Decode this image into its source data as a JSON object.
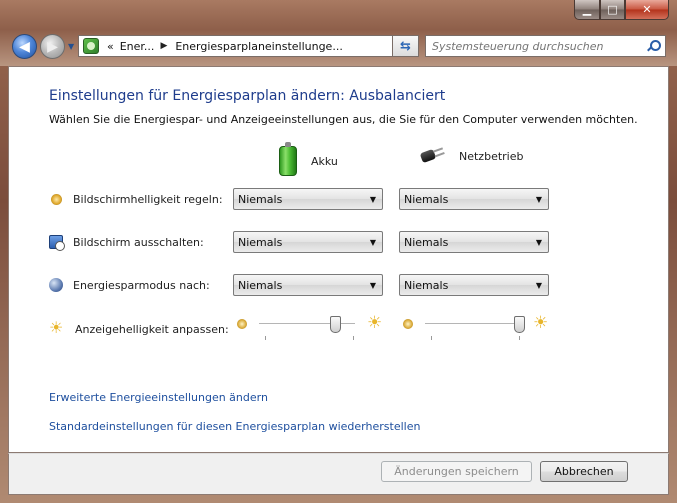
{
  "window": {
    "controls": {
      "minimize": "▁",
      "maximize": "□",
      "close": "✕"
    }
  },
  "nav": {
    "breadcrumb": [
      "Ener...",
      "Energiesparplaneinstellunge..."
    ],
    "breadcrumb_prefix": "«",
    "search_placeholder": "Systemsteuerung durchsuchen"
  },
  "page": {
    "title": "Einstellungen für Energiesparplan ändern: Ausbalanciert",
    "subtitle": "Wählen Sie die Energiespar- und Anzeigeeinstellungen aus, die Sie für den Computer verwenden möchten.",
    "columns": {
      "battery": "Akku",
      "plugged_in": "Netzbetrieb"
    },
    "settings": [
      {
        "label": "Bildschirmhelligkeit regeln:",
        "icon": "brightness-icon",
        "battery": "Niemals",
        "plugged_in": "Niemals"
      },
      {
        "label": "Bildschirm ausschalten:",
        "icon": "monitor-timer-icon",
        "battery": "Niemals",
        "plugged_in": "Niemals"
      },
      {
        "label": "Energiesparmodus nach:",
        "icon": "sleep-icon",
        "battery": "Niemals",
        "plugged_in": "Niemals"
      }
    ],
    "brightness": {
      "label": "Anzeigehelligkeit anpassen:",
      "battery_level": 0.8,
      "plugged_in_level": 0.98
    },
    "links": {
      "advanced": "Erweiterte Energieeinstellungen ändern",
      "restore": "Standardeinstellungen für diesen Energiesparplan wiederherstellen"
    },
    "buttons": {
      "save": "Änderungen speichern",
      "cancel": "Abbrechen"
    }
  },
  "colors": {
    "title": "#1e3c8c",
    "link": "#1e4f9e",
    "disabled_text": "#8d8d8d"
  }
}
